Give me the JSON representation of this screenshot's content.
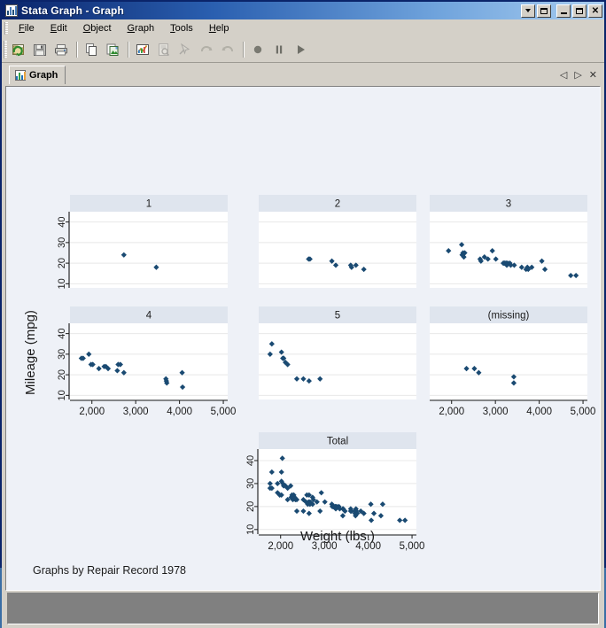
{
  "window": {
    "title": "Stata Graph - Graph",
    "icon": "stata-graph-icon",
    "controls": {
      "mdi_dropdown": "▾",
      "mdi_restore": "restore",
      "minimize": "_",
      "maximize": "□",
      "close": "✕"
    }
  },
  "menubar": {
    "items": [
      {
        "label": "File",
        "accel": "F"
      },
      {
        "label": "Edit",
        "accel": "E"
      },
      {
        "label": "Object",
        "accel": "O"
      },
      {
        "label": "Graph",
        "accel": "G"
      },
      {
        "label": "Tools",
        "accel": "T"
      },
      {
        "label": "Help",
        "accel": "H"
      }
    ]
  },
  "toolbar": {
    "buttons": [
      {
        "name": "open-graph-icon",
        "title": "Open",
        "enabled": true
      },
      {
        "name": "save-graph-icon",
        "title": "Save",
        "enabled": true
      },
      {
        "name": "print-graph-icon",
        "title": "Print",
        "enabled": true
      },
      {
        "name": "separator",
        "title": "",
        "enabled": true
      },
      {
        "name": "copy-icon",
        "title": "Copy",
        "enabled": true
      },
      {
        "name": "paste-graph-icon",
        "title": "Paste",
        "enabled": true
      },
      {
        "name": "separator",
        "title": "",
        "enabled": true
      },
      {
        "name": "graph-editor-icon",
        "title": "Start Graph Editor",
        "enabled": true
      },
      {
        "name": "inspect-icon",
        "title": "Object Browser",
        "enabled": false
      },
      {
        "name": "pointer-icon",
        "title": "Pointer Tool",
        "enabled": false
      },
      {
        "name": "undo-icon",
        "title": "Undo",
        "enabled": false
      },
      {
        "name": "redo-icon",
        "title": "Redo",
        "enabled": false
      },
      {
        "name": "separator",
        "title": "",
        "enabled": true
      },
      {
        "name": "record-icon",
        "title": "Record",
        "enabled": true
      },
      {
        "name": "pause-icon",
        "title": "Pause",
        "enabled": true
      },
      {
        "name": "play-icon",
        "title": "Play",
        "enabled": true
      }
    ]
  },
  "tabs": {
    "items": [
      {
        "label": "Graph",
        "icon": "graph-tab-icon",
        "active": true
      }
    ],
    "controls": {
      "scroll_left": "◁",
      "scroll_right": "▷",
      "close": "✕"
    }
  },
  "colors": {
    "graph_background": "#eef1f7",
    "plot_background": "#ffffff",
    "panel_title_strip": "#dfe5ee",
    "marker": "#1a4a72",
    "axis": "#1a1a1a",
    "gridline": "#e8e8e8",
    "titlebar_start": "#0a246a",
    "titlebar_end": "#a8cdf0",
    "window_face": "#d4d0c8"
  },
  "chart_data": {
    "type": "scatter",
    "title": "",
    "xlabel": "Weight (lbs.)",
    "ylabel": "Mileage (mpg)",
    "note": "Graphs by Repair Record 1978",
    "by_variable": "Repair Record 1978",
    "xlim": [
      1500,
      5100
    ],
    "ylim": [
      8,
      45
    ],
    "xticks": [
      2000,
      3000,
      4000,
      5000
    ],
    "xticklabels": [
      "2,000",
      "3,000",
      "4,000",
      "5,000"
    ],
    "yticks": [
      10,
      20,
      30,
      40
    ],
    "yticklabels": [
      "10",
      "20",
      "30",
      "40"
    ],
    "grid": "horizontal",
    "legend": "none",
    "panels": [
      {
        "label": "1",
        "row": 0,
        "col": 0,
        "show_yaxis": true,
        "show_xaxis": false,
        "n": 2,
        "points": [
          {
            "x": 2730,
            "y": 24
          },
          {
            "x": 3470,
            "y": 18
          }
        ]
      },
      {
        "label": "2",
        "row": 0,
        "col": 1,
        "show_yaxis": false,
        "show_xaxis": false,
        "n": 8,
        "points": [
          {
            "x": 2640,
            "y": 22
          },
          {
            "x": 2670,
            "y": 22
          },
          {
            "x": 3170,
            "y": 21
          },
          {
            "x": 3260,
            "y": 19
          },
          {
            "x": 3600,
            "y": 19
          },
          {
            "x": 3620,
            "y": 18
          },
          {
            "x": 3720,
            "y": 19
          },
          {
            "x": 3900,
            "y": 17
          }
        ]
      },
      {
        "label": "3",
        "row": 0,
        "col": 2,
        "show_yaxis": false,
        "show_xaxis": false,
        "n": 30,
        "points": [
          {
            "x": 1930,
            "y": 26
          },
          {
            "x": 2230,
            "y": 29
          },
          {
            "x": 2240,
            "y": 24
          },
          {
            "x": 2260,
            "y": 25
          },
          {
            "x": 2280,
            "y": 23
          },
          {
            "x": 2300,
            "y": 25
          },
          {
            "x": 2650,
            "y": 22
          },
          {
            "x": 2670,
            "y": 21
          },
          {
            "x": 2750,
            "y": 23
          },
          {
            "x": 2830,
            "y": 22
          },
          {
            "x": 2930,
            "y": 26
          },
          {
            "x": 3010,
            "y": 22
          },
          {
            "x": 3180,
            "y": 20
          },
          {
            "x": 3200,
            "y": 20
          },
          {
            "x": 3220,
            "y": 20
          },
          {
            "x": 3250,
            "y": 20
          },
          {
            "x": 3260,
            "y": 19
          },
          {
            "x": 3280,
            "y": 20
          },
          {
            "x": 3330,
            "y": 20
          },
          {
            "x": 3350,
            "y": 19
          },
          {
            "x": 3430,
            "y": 19
          },
          {
            "x": 3600,
            "y": 18
          },
          {
            "x": 3700,
            "y": 17
          },
          {
            "x": 3730,
            "y": 18
          },
          {
            "x": 3750,
            "y": 17
          },
          {
            "x": 3830,
            "y": 18
          },
          {
            "x": 4060,
            "y": 21
          },
          {
            "x": 4130,
            "y": 17
          },
          {
            "x": 4720,
            "y": 14
          },
          {
            "x": 4840,
            "y": 14
          }
        ]
      },
      {
        "label": "4",
        "row": 1,
        "col": 0,
        "show_yaxis": true,
        "show_xaxis": true,
        "n": 18,
        "points": [
          {
            "x": 1760,
            "y": 28
          },
          {
            "x": 1800,
            "y": 28
          },
          {
            "x": 1930,
            "y": 30
          },
          {
            "x": 1980,
            "y": 25
          },
          {
            "x": 2020,
            "y": 25
          },
          {
            "x": 2160,
            "y": 23
          },
          {
            "x": 2280,
            "y": 24
          },
          {
            "x": 2320,
            "y": 24
          },
          {
            "x": 2370,
            "y": 23
          },
          {
            "x": 2580,
            "y": 22
          },
          {
            "x": 2600,
            "y": 25
          },
          {
            "x": 2650,
            "y": 25
          },
          {
            "x": 2730,
            "y": 21
          },
          {
            "x": 3690,
            "y": 18
          },
          {
            "x": 3700,
            "y": 17
          },
          {
            "x": 3710,
            "y": 16
          },
          {
            "x": 4060,
            "y": 21
          },
          {
            "x": 4070,
            "y": 14
          }
        ]
      },
      {
        "label": "5",
        "row": 1,
        "col": 1,
        "show_yaxis": false,
        "show_xaxis": false,
        "n": 11,
        "points": [
          {
            "x": 1800,
            "y": 35
          },
          {
            "x": 1760,
            "y": 30
          },
          {
            "x": 2020,
            "y": 31
          },
          {
            "x": 2050,
            "y": 28
          },
          {
            "x": 2070,
            "y": 28
          },
          {
            "x": 2110,
            "y": 26
          },
          {
            "x": 2160,
            "y": 25
          },
          {
            "x": 2370,
            "y": 18
          },
          {
            "x": 2520,
            "y": 18
          },
          {
            "x": 2650,
            "y": 17
          },
          {
            "x": 2900,
            "y": 18
          }
        ]
      },
      {
        "label": "(missing)",
        "row": 1,
        "col": 2,
        "show_yaxis": false,
        "show_xaxis": true,
        "n": 5,
        "points": [
          {
            "x": 2340,
            "y": 23
          },
          {
            "x": 2520,
            "y": 23
          },
          {
            "x": 2620,
            "y": 21
          },
          {
            "x": 3420,
            "y": 19
          },
          {
            "x": 3420,
            "y": 16
          }
        ]
      },
      {
        "label": "Total",
        "row": 2,
        "col": 1,
        "show_yaxis": true,
        "show_xaxis": true,
        "n": 74,
        "points": [
          {
            "x": 2040,
            "y": 41
          },
          {
            "x": 1800,
            "y": 35
          },
          {
            "x": 2020,
            "y": 35
          },
          {
            "x": 1760,
            "y": 30
          },
          {
            "x": 2020,
            "y": 31
          },
          {
            "x": 2050,
            "y": 30
          },
          {
            "x": 2070,
            "y": 29
          },
          {
            "x": 2110,
            "y": 29
          },
          {
            "x": 2160,
            "y": 28
          },
          {
            "x": 1930,
            "y": 26
          },
          {
            "x": 1760,
            "y": 28
          },
          {
            "x": 1800,
            "y": 28
          },
          {
            "x": 1930,
            "y": 30
          },
          {
            "x": 1980,
            "y": 25
          },
          {
            "x": 2020,
            "y": 25
          },
          {
            "x": 2160,
            "y": 23
          },
          {
            "x": 2230,
            "y": 29
          },
          {
            "x": 2240,
            "y": 24
          },
          {
            "x": 2260,
            "y": 25
          },
          {
            "x": 2280,
            "y": 23
          },
          {
            "x": 2300,
            "y": 25
          },
          {
            "x": 2340,
            "y": 23
          },
          {
            "x": 2370,
            "y": 23
          },
          {
            "x": 2280,
            "y": 24
          },
          {
            "x": 2320,
            "y": 24
          },
          {
            "x": 2370,
            "y": 18
          },
          {
            "x": 2520,
            "y": 23
          },
          {
            "x": 2520,
            "y": 18
          },
          {
            "x": 2580,
            "y": 22
          },
          {
            "x": 2600,
            "y": 25
          },
          {
            "x": 2620,
            "y": 21
          },
          {
            "x": 2640,
            "y": 22
          },
          {
            "x": 2650,
            "y": 25
          },
          {
            "x": 2650,
            "y": 17
          },
          {
            "x": 2670,
            "y": 22
          },
          {
            "x": 2670,
            "y": 21
          },
          {
            "x": 2730,
            "y": 24
          },
          {
            "x": 2730,
            "y": 21
          },
          {
            "x": 2750,
            "y": 23
          },
          {
            "x": 2830,
            "y": 22
          },
          {
            "x": 2900,
            "y": 18
          },
          {
            "x": 2930,
            "y": 26
          },
          {
            "x": 3010,
            "y": 22
          },
          {
            "x": 3170,
            "y": 21
          },
          {
            "x": 3180,
            "y": 20
          },
          {
            "x": 3200,
            "y": 20
          },
          {
            "x": 3220,
            "y": 20
          },
          {
            "x": 3250,
            "y": 20
          },
          {
            "x": 3260,
            "y": 19
          },
          {
            "x": 3280,
            "y": 20
          },
          {
            "x": 3330,
            "y": 20
          },
          {
            "x": 3350,
            "y": 19
          },
          {
            "x": 3420,
            "y": 19
          },
          {
            "x": 3420,
            "y": 16
          },
          {
            "x": 3430,
            "y": 19
          },
          {
            "x": 3470,
            "y": 18
          },
          {
            "x": 3600,
            "y": 19
          },
          {
            "x": 3600,
            "y": 18
          },
          {
            "x": 3620,
            "y": 18
          },
          {
            "x": 3690,
            "y": 18
          },
          {
            "x": 3700,
            "y": 17
          },
          {
            "x": 3710,
            "y": 16
          },
          {
            "x": 3720,
            "y": 19
          },
          {
            "x": 3730,
            "y": 18
          },
          {
            "x": 3750,
            "y": 17
          },
          {
            "x": 3830,
            "y": 18
          },
          {
            "x": 3900,
            "y": 17
          },
          {
            "x": 4060,
            "y": 21
          },
          {
            "x": 4070,
            "y": 14
          },
          {
            "x": 4130,
            "y": 17
          },
          {
            "x": 4290,
            "y": 16
          },
          {
            "x": 4330,
            "y": 21
          },
          {
            "x": 4720,
            "y": 14
          },
          {
            "x": 4840,
            "y": 14
          }
        ]
      }
    ]
  }
}
